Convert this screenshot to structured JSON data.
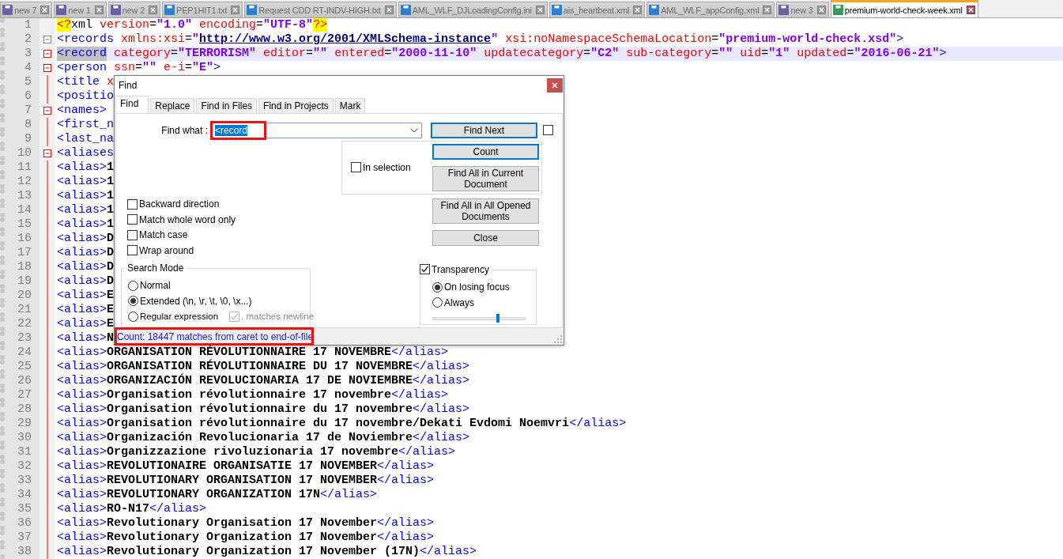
{
  "tabs": [
    {
      "label": "new 7",
      "selected": false,
      "color": "#6b5fa8"
    },
    {
      "label": "new 1",
      "selected": false,
      "color": "#6b5fa8"
    },
    {
      "label": "new 2",
      "selected": false,
      "color": "#6b5fa8"
    },
    {
      "label": "PEP1HIT1.txt",
      "selected": false,
      "color": "#2a7fd4"
    },
    {
      "label": "Request CDD RT-INDV-HIGH.txt",
      "selected": false,
      "color": "#2a7fd4"
    },
    {
      "label": "AML_WLF_DJLoadingConfig.ini",
      "selected": false,
      "color": "#2a7fd4"
    },
    {
      "label": "ais_heartbeat.xml",
      "selected": false,
      "color": "#2a7fd4"
    },
    {
      "label": "AML_WLF_appConfig.xml",
      "selected": false,
      "color": "#2a7fd4"
    },
    {
      "label": "new 3",
      "selected": false,
      "color": "#6b5fa8"
    },
    {
      "label": "premium-world-check-week.xml",
      "selected": true,
      "color": "#3a9a5a"
    }
  ],
  "editor": {
    "lines": [
      {
        "number": "1",
        "current": false,
        "collapsible": false,
        "in_block": false,
        "segments": [
          {
            "kind": "pi",
            "text": "<?"
          },
          {
            "kind": "plain",
            "text": "xml"
          },
          {
            "kind": "attr",
            "text": " version"
          },
          {
            "kind": "op",
            "text": "="
          },
          {
            "kind": "value",
            "text": "\"1.0\""
          },
          {
            "kind": "attr",
            "text": " encoding"
          },
          {
            "kind": "op",
            "text": "="
          },
          {
            "kind": "value",
            "text": "\"UTF-8\""
          },
          {
            "kind": "pi",
            "text": "?>"
          }
        ]
      },
      {
        "number": "2",
        "current": false,
        "collapsible": true,
        "in_block": false,
        "segments": [
          {
            "kind": "tag",
            "text": "<records"
          },
          {
            "kind": "attr",
            "text": " xmlns:xsi"
          },
          {
            "kind": "op",
            "text": "="
          },
          {
            "kind": "value",
            "text": "\""
          },
          {
            "kind": "link",
            "text": "http://www.w3.org/2001/XMLSchema-instance"
          },
          {
            "kind": "value",
            "text": "\""
          },
          {
            "kind": "attr",
            "text": " xsi:noNamespaceSchemaLocation"
          },
          {
            "kind": "op",
            "text": "="
          },
          {
            "kind": "value",
            "text": "\"premium-world-check.xsd\""
          },
          {
            "kind": "tag",
            "text": ">"
          }
        ]
      },
      {
        "number": "3",
        "current": true,
        "collapsible": true,
        "in_block": true,
        "segments": [
          {
            "kind": "tag",
            "text": "<record",
            "selected": true
          },
          {
            "kind": "attr",
            "text": " category"
          },
          {
            "kind": "op",
            "text": "="
          },
          {
            "kind": "value",
            "text": "\"TERRORISM\""
          },
          {
            "kind": "attr",
            "text": " editor"
          },
          {
            "kind": "op",
            "text": "="
          },
          {
            "kind": "value",
            "text": "\"\""
          },
          {
            "kind": "attr",
            "text": " entered"
          },
          {
            "kind": "op",
            "text": "="
          },
          {
            "kind": "value",
            "text": "\"2000-11-10\""
          },
          {
            "kind": "attr",
            "text": " updatecategory"
          },
          {
            "kind": "op",
            "text": "="
          },
          {
            "kind": "value",
            "text": "\"C2\""
          },
          {
            "kind": "attr",
            "text": " sub-category"
          },
          {
            "kind": "op",
            "text": "="
          },
          {
            "kind": "value",
            "text": "\"\""
          },
          {
            "kind": "attr",
            "text": " uid"
          },
          {
            "kind": "op",
            "text": "="
          },
          {
            "kind": "value",
            "text": "\"1\""
          },
          {
            "kind": "attr",
            "text": " updated"
          },
          {
            "kind": "op",
            "text": "="
          },
          {
            "kind": "value",
            "text": "\"2016-06-21\""
          },
          {
            "kind": "tag",
            "text": ">"
          }
        ]
      },
      {
        "number": "4",
        "current": false,
        "collapsible": true,
        "in_block": true,
        "segments": [
          {
            "kind": "tag",
            "text": "<person"
          },
          {
            "kind": "attr",
            "text": " ssn"
          },
          {
            "kind": "op",
            "text": "="
          },
          {
            "kind": "value",
            "text": "\"\""
          },
          {
            "kind": "attr",
            "text": " e-i"
          },
          {
            "kind": "op",
            "text": "="
          },
          {
            "kind": "value",
            "text": "\"E\""
          },
          {
            "kind": "tag",
            "text": ">"
          }
        ]
      },
      {
        "number": "5",
        "current": false,
        "collapsible": false,
        "in_block": true,
        "segments": [
          {
            "kind": "tag",
            "text": "<title"
          },
          {
            "kind": "attr",
            "text": " x"
          }
        ]
      },
      {
        "number": "6",
        "current": false,
        "collapsible": false,
        "in_block": true,
        "segments": [
          {
            "kind": "tag",
            "text": "<positio"
          }
        ]
      },
      {
        "number": "7",
        "current": false,
        "collapsible": true,
        "in_block": true,
        "segments": [
          {
            "kind": "tag",
            "text": "<names>"
          }
        ]
      },
      {
        "number": "8",
        "current": false,
        "collapsible": false,
        "in_block": true,
        "segments": [
          {
            "kind": "tag",
            "text": "<first_n"
          }
        ]
      },
      {
        "number": "9",
        "current": false,
        "collapsible": false,
        "in_block": true,
        "segments": [
          {
            "kind": "tag",
            "text": "<last_na"
          }
        ]
      },
      {
        "number": "10",
        "current": false,
        "collapsible": true,
        "in_block": true,
        "segments": [
          {
            "kind": "tag",
            "text": "<aliases"
          }
        ]
      },
      {
        "number": "11",
        "current": false,
        "collapsible": false,
        "in_block": true,
        "segments": [
          {
            "kind": "tag",
            "text": "<alias>"
          },
          {
            "kind": "text",
            "text": "1"
          }
        ]
      },
      {
        "number": "12",
        "current": false,
        "collapsible": false,
        "in_block": true,
        "segments": [
          {
            "kind": "tag",
            "text": "<alias>"
          },
          {
            "kind": "text",
            "text": "1"
          }
        ]
      },
      {
        "number": "13",
        "current": false,
        "collapsible": false,
        "in_block": true,
        "segments": [
          {
            "kind": "tag",
            "text": "<alias>"
          },
          {
            "kind": "text",
            "text": "1"
          }
        ]
      },
      {
        "number": "14",
        "current": false,
        "collapsible": false,
        "in_block": true,
        "segments": [
          {
            "kind": "tag",
            "text": "<alias>"
          },
          {
            "kind": "text",
            "text": "1"
          }
        ]
      },
      {
        "number": "15",
        "current": false,
        "collapsible": false,
        "in_block": true,
        "segments": [
          {
            "kind": "tag",
            "text": "<alias>"
          },
          {
            "kind": "text",
            "text": "1"
          }
        ]
      },
      {
        "number": "16",
        "current": false,
        "collapsible": false,
        "in_block": true,
        "segments": [
          {
            "kind": "tag",
            "text": "<alias>"
          },
          {
            "kind": "text",
            "text": "D"
          }
        ]
      },
      {
        "number": "17",
        "current": false,
        "collapsible": false,
        "in_block": true,
        "segments": [
          {
            "kind": "tag",
            "text": "<alias>"
          },
          {
            "kind": "text",
            "text": "D"
          }
        ]
      },
      {
        "number": "18",
        "current": false,
        "collapsible": false,
        "in_block": true,
        "segments": [
          {
            "kind": "tag",
            "text": "<alias>"
          },
          {
            "kind": "text",
            "text": "D"
          }
        ]
      },
      {
        "number": "19",
        "current": false,
        "collapsible": false,
        "in_block": true,
        "segments": [
          {
            "kind": "tag",
            "text": "<alias>"
          },
          {
            "kind": "text",
            "text": "D"
          }
        ]
      },
      {
        "number": "20",
        "current": false,
        "collapsible": false,
        "in_block": true,
        "segments": [
          {
            "kind": "tag",
            "text": "<alias>"
          },
          {
            "kind": "text",
            "text": "E"
          }
        ]
      },
      {
        "number": "21",
        "current": false,
        "collapsible": false,
        "in_block": true,
        "segments": [
          {
            "kind": "tag",
            "text": "<alias>"
          },
          {
            "kind": "text",
            "text": "E"
          }
        ]
      },
      {
        "number": "22",
        "current": false,
        "collapsible": false,
        "in_block": true,
        "segments": [
          {
            "kind": "tag",
            "text": "<alias>"
          },
          {
            "kind": "text",
            "text": "E"
          }
        ]
      },
      {
        "number": "23",
        "current": false,
        "collapsible": false,
        "in_block": true,
        "segments": [
          {
            "kind": "tag",
            "text": "<alias>"
          },
          {
            "kind": "text",
            "text": "N"
          }
        ]
      },
      {
        "number": "24",
        "current": false,
        "collapsible": false,
        "in_block": true,
        "segments": [
          {
            "kind": "tag",
            "text": "<alias>"
          },
          {
            "kind": "text",
            "text": "ORGANISATION RÉVOLUTIONNAIRE 17 NOVEMBRE"
          },
          {
            "kind": "tag",
            "text": "</alias>"
          }
        ]
      },
      {
        "number": "25",
        "current": false,
        "collapsible": false,
        "in_block": true,
        "segments": [
          {
            "kind": "tag",
            "text": "<alias>"
          },
          {
            "kind": "text",
            "text": "ORGANISATION RÉVOLUTIONNAIRE DU 17 NOVEMBRE"
          },
          {
            "kind": "tag",
            "text": "</alias>"
          }
        ]
      },
      {
        "number": "26",
        "current": false,
        "collapsible": false,
        "in_block": true,
        "segments": [
          {
            "kind": "tag",
            "text": "<alias>"
          },
          {
            "kind": "text",
            "text": "ORGANIZACIÓN REVOLUCIONARIA 17 DE NOVIEMBRE"
          },
          {
            "kind": "tag",
            "text": "</alias>"
          }
        ]
      },
      {
        "number": "27",
        "current": false,
        "collapsible": false,
        "in_block": true,
        "segments": [
          {
            "kind": "tag",
            "text": "<alias>"
          },
          {
            "kind": "text",
            "text": "Organisation révolutionnaire 17 novembre"
          },
          {
            "kind": "tag",
            "text": "</alias>"
          }
        ]
      },
      {
        "number": "28",
        "current": false,
        "collapsible": false,
        "in_block": true,
        "segments": [
          {
            "kind": "tag",
            "text": "<alias>"
          },
          {
            "kind": "text",
            "text": "Organisation révolutionnaire du 17 novembre"
          },
          {
            "kind": "tag",
            "text": "</alias>"
          }
        ]
      },
      {
        "number": "29",
        "current": false,
        "collapsible": false,
        "in_block": true,
        "segments": [
          {
            "kind": "tag",
            "text": "<alias>"
          },
          {
            "kind": "text",
            "text": "Organisation révolutionnaire du 17 novembre/Dekati Evdomi Noemvri"
          },
          {
            "kind": "tag",
            "text": "</alias>"
          }
        ]
      },
      {
        "number": "30",
        "current": false,
        "collapsible": false,
        "in_block": true,
        "segments": [
          {
            "kind": "tag",
            "text": "<alias>"
          },
          {
            "kind": "text",
            "text": "Organización Revolucionaria 17 de Noviembre"
          },
          {
            "kind": "tag",
            "text": "</alias>"
          }
        ]
      },
      {
        "number": "31",
        "current": false,
        "collapsible": false,
        "in_block": true,
        "segments": [
          {
            "kind": "tag",
            "text": "<alias>"
          },
          {
            "kind": "text",
            "text": "Organizzazione rivoluzionaria 17 novembre"
          },
          {
            "kind": "tag",
            "text": "</alias>"
          }
        ]
      },
      {
        "number": "32",
        "current": false,
        "collapsible": false,
        "in_block": true,
        "segments": [
          {
            "kind": "tag",
            "text": "<alias>"
          },
          {
            "kind": "text",
            "text": "REVOLUTIONAIRE ORGANISATIE 17 NOVEMBER"
          },
          {
            "kind": "tag",
            "text": "</alias>"
          }
        ]
      },
      {
        "number": "33",
        "current": false,
        "collapsible": false,
        "in_block": true,
        "segments": [
          {
            "kind": "tag",
            "text": "<alias>"
          },
          {
            "kind": "text",
            "text": "REVOLUTIONARY ORGANISATION 17 NOVEMBER"
          },
          {
            "kind": "tag",
            "text": "</alias>"
          }
        ]
      },
      {
        "number": "34",
        "current": false,
        "collapsible": false,
        "in_block": true,
        "segments": [
          {
            "kind": "tag",
            "text": "<alias>"
          },
          {
            "kind": "text",
            "text": "REVOLUTIONARY ORGANIZATION 17N"
          },
          {
            "kind": "tag",
            "text": "</alias>"
          }
        ]
      },
      {
        "number": "35",
        "current": false,
        "collapsible": false,
        "in_block": true,
        "segments": [
          {
            "kind": "tag",
            "text": "<alias>"
          },
          {
            "kind": "text",
            "text": "RO-N17"
          },
          {
            "kind": "tag",
            "text": "</alias>"
          }
        ]
      },
      {
        "number": "36",
        "current": false,
        "collapsible": false,
        "in_block": true,
        "segments": [
          {
            "kind": "tag",
            "text": "<alias>"
          },
          {
            "kind": "text",
            "text": "Revolutionary Organisation 17 November"
          },
          {
            "kind": "tag",
            "text": "</alias>"
          }
        ]
      },
      {
        "number": "37",
        "current": false,
        "collapsible": false,
        "in_block": true,
        "segments": [
          {
            "kind": "tag",
            "text": "<alias>"
          },
          {
            "kind": "text",
            "text": "Revolutionary Organization 17 November"
          },
          {
            "kind": "tag",
            "text": "</alias>"
          }
        ]
      },
      {
        "number": "38",
        "current": false,
        "collapsible": false,
        "in_block": true,
        "segments": [
          {
            "kind": "tag",
            "text": "<alias>"
          },
          {
            "kind": "text",
            "text": "Revolutionary Organization 17 November (17N)"
          },
          {
            "kind": "tag",
            "text": "</alias>"
          }
        ]
      }
    ]
  },
  "find_dialog": {
    "title": "Find",
    "tabs": [
      {
        "label": "Find",
        "selected": true
      },
      {
        "label": "Replace",
        "selected": false
      },
      {
        "label": "Find in Files",
        "selected": false
      },
      {
        "label": "Find in Projects",
        "selected": false
      },
      {
        "label": "Mark",
        "selected": false
      }
    ],
    "find_what": {
      "label": "Find what :",
      "value": "<record",
      "highlighted": true
    },
    "find_next": {
      "label": "Find Next",
      "focused": true
    },
    "side_checkbox": {
      "checked": false
    },
    "in_selection": {
      "label": "In selection",
      "checked": false
    },
    "count": {
      "label": "Count",
      "focused": true
    },
    "find_all_current": {
      "label": "Find All in Current Document",
      "focused": false
    },
    "find_all_opened": {
      "label": "Find All in All Opened Documents",
      "focused": false
    },
    "close": {
      "label": "Close",
      "focused": false
    },
    "options": [
      {
        "label": "Backward direction",
        "checked": false
      },
      {
        "label": "Match whole word only",
        "checked": false
      },
      {
        "label": "Match case",
        "checked": false
      },
      {
        "label": "Wrap around",
        "checked": false
      }
    ],
    "search_mode": {
      "title": "Search Mode",
      "modes": [
        {
          "label": "Normal",
          "selected": false
        },
        {
          "label": "Extended (\\n, \\r, \\t, \\0, \\x...)",
          "selected": true
        },
        {
          "label": "Regular expression",
          "selected": false
        }
      ],
      "matches_newline": {
        "label": ". matches newline",
        "checked": true,
        "disabled": true
      }
    },
    "transparency": {
      "label": "Transparency",
      "checked": true,
      "modes": [
        {
          "label": "On losing focus",
          "selected": true
        },
        {
          "label": "Always",
          "selected": false
        }
      ],
      "level": 0.71
    },
    "status": {
      "text": "Count: 18447 matches from caret to end-of-file",
      "highlighted": true
    }
  }
}
